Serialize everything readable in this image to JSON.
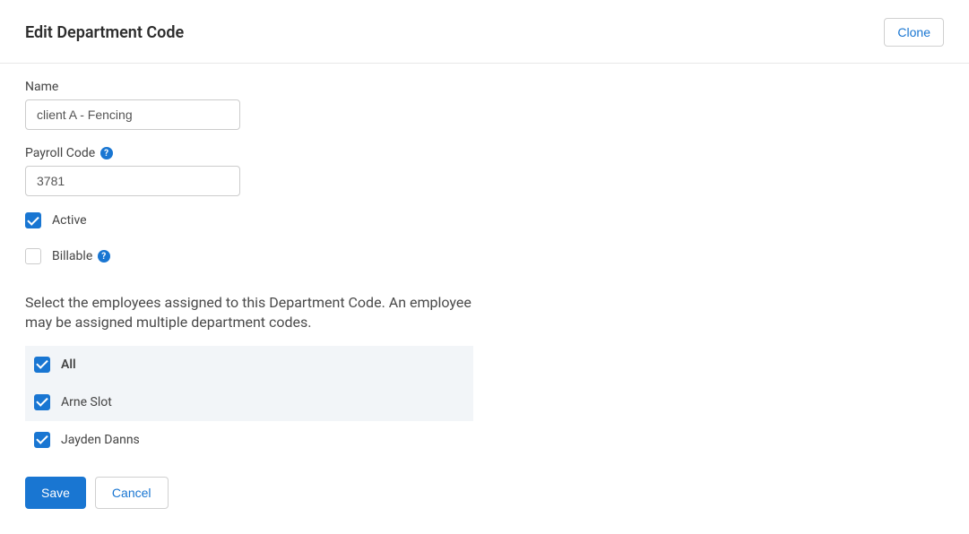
{
  "header": {
    "title": "Edit Department Code",
    "clone_label": "Clone"
  },
  "form": {
    "name_label": "Name",
    "name_value": "client A - Fencing",
    "payroll_code_label": "Payroll Code",
    "payroll_code_value": "3781",
    "active_label": "Active",
    "active_checked": true,
    "billable_label": "Billable",
    "billable_checked": false
  },
  "employees": {
    "section_text": "Select the employees assigned to this Department Code. An employee may be assigned multiple department codes.",
    "all_label": "All",
    "all_checked": true,
    "items": [
      {
        "name": "Arne Slot",
        "checked": true
      },
      {
        "name": "Jayden Danns",
        "checked": true
      }
    ]
  },
  "buttons": {
    "save_label": "Save",
    "cancel_label": "Cancel"
  }
}
